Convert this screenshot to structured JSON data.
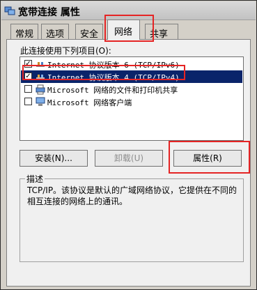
{
  "window": {
    "title": "宽带连接 属性",
    "title_icon": "network-connection-icon"
  },
  "tabs": [
    {
      "label": "常规",
      "active": false
    },
    {
      "label": "选项",
      "active": false
    },
    {
      "label": "安全",
      "active": false
    },
    {
      "label": "网络",
      "active": true
    },
    {
      "label": "共享",
      "active": false
    }
  ],
  "network": {
    "items_label": "此连接使用下列项目(O):",
    "items": [
      {
        "text": "Internet 协议版本 6 (TCP/IPv6)",
        "checked": true,
        "selected": false,
        "icon": "protocol-icon"
      },
      {
        "text": "Internet 协议版本 4 (TCP/IPv4)",
        "checked": true,
        "selected": true,
        "icon": "protocol-icon"
      },
      {
        "text": "Microsoft 网络的文件和打印机共享",
        "checked": false,
        "selected": false,
        "icon": "file-printer-sharing-icon"
      },
      {
        "text": "Microsoft 网络客户端",
        "checked": false,
        "selected": false,
        "icon": "network-client-icon"
      }
    ],
    "buttons": {
      "install": "安装(N)...",
      "uninstall": "卸载(U)",
      "properties": "属性(R)"
    },
    "description": {
      "title": "描述",
      "text": "TCP/IP。该协议是默认的广域网络协议，它提供在不同的相互连接的网络上的通讯。"
    }
  },
  "highlight_color": "#e52424",
  "selection_color": "#0a246a"
}
